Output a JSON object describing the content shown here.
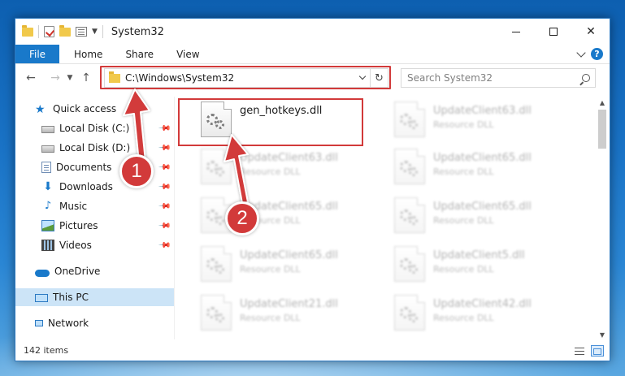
{
  "window": {
    "title": "System32",
    "controls": {
      "minimize": "",
      "maximize": "",
      "close": "✕"
    }
  },
  "ribbon": {
    "tabs": [
      {
        "label": "File"
      },
      {
        "label": "Home"
      },
      {
        "label": "Share"
      },
      {
        "label": "View"
      }
    ],
    "help": "?"
  },
  "nav": {
    "address": "C:\\Windows\\System32",
    "search_placeholder": "Search System32"
  },
  "sidebar": {
    "items": [
      {
        "label": "Quick access",
        "icon": "star-icon",
        "pinned": false
      },
      {
        "label": "Local Disk (C:)",
        "icon": "disk-icon",
        "pinned": true
      },
      {
        "label": "Local Disk (D:)",
        "icon": "disk-icon",
        "pinned": true
      },
      {
        "label": "Documents",
        "icon": "documents-icon",
        "pinned": true
      },
      {
        "label": "Downloads",
        "icon": "downloads-icon",
        "pinned": true
      },
      {
        "label": "Music",
        "icon": "music-icon",
        "pinned": true
      },
      {
        "label": "Pictures",
        "icon": "pictures-icon",
        "pinned": true
      },
      {
        "label": "Videos",
        "icon": "videos-icon",
        "pinned": true
      },
      {
        "label": "OneDrive",
        "icon": "onedrive-icon",
        "pinned": false
      },
      {
        "label": "This PC",
        "icon": "this-pc-icon",
        "pinned": false,
        "selected": true
      },
      {
        "label": "Network",
        "icon": "network-icon",
        "pinned": false
      }
    ]
  },
  "files": {
    "highlighted": {
      "name": "gen_hotkeys.dll",
      "type": ""
    },
    "items": [
      {
        "name": "UpdateClient63.dll",
        "type": "Resource DLL"
      },
      {
        "name": "UpdateClient63.dll",
        "type": "Resource DLL"
      },
      {
        "name": "UpdateClient65.dll",
        "type": "Resource DLL"
      },
      {
        "name": "UpdateClient65.dll",
        "type": "Resource DLL"
      },
      {
        "name": "UpdateClient65.dll",
        "type": "Resource DLL"
      },
      {
        "name": "UpdateClient65.dll",
        "type": "Resource DLL"
      },
      {
        "name": "UpdateClient5.dll",
        "type": "Resource DLL"
      },
      {
        "name": "UpdateClient21.dll",
        "type": "Resource DLL"
      },
      {
        "name": "UpdateClient42.dll",
        "type": "Resource DLL"
      }
    ]
  },
  "status": {
    "item_count": "142 items"
  },
  "annotations": {
    "step1": "1",
    "step2": "2",
    "color": "#d23a3a"
  }
}
